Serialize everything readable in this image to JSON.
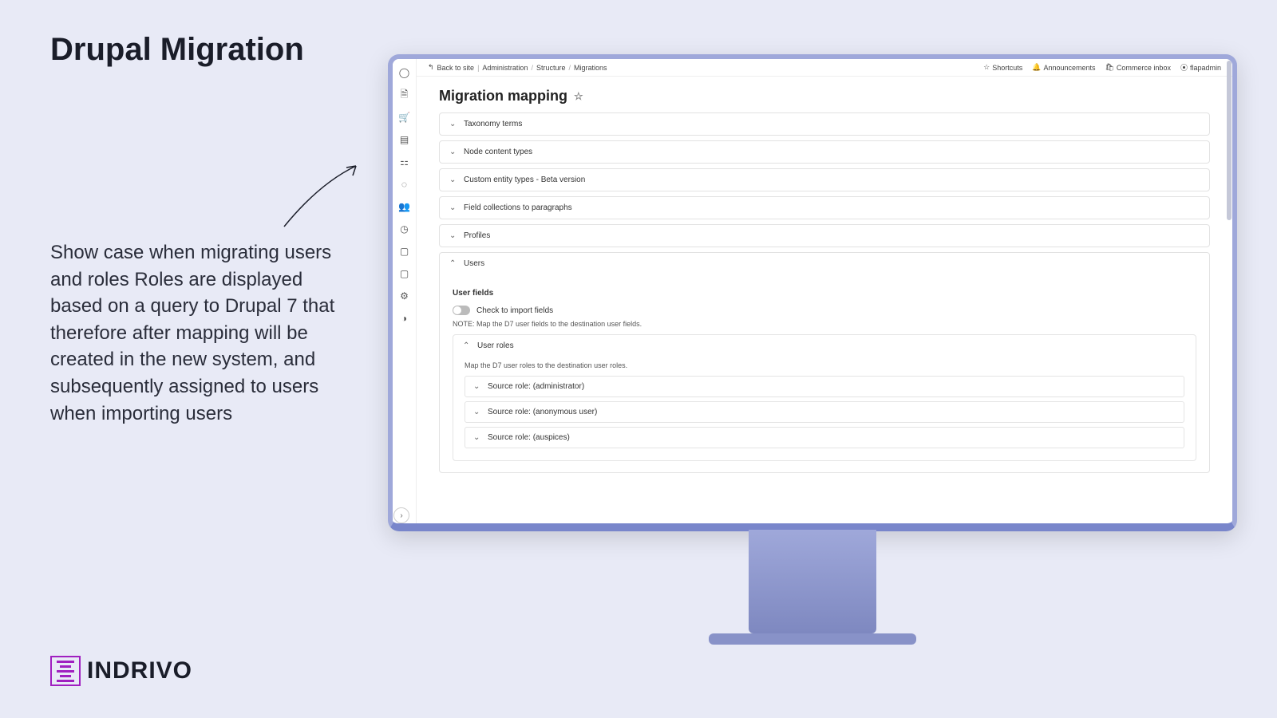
{
  "slide": {
    "title": "Drupal Migration",
    "callout": "Show case when migrating users and roles Roles are displayed based on a query to Drupal 7 that therefore after mapping will be created in the new system, and subsequently assigned to users when importing users"
  },
  "logo": {
    "text": "INDRIVO"
  },
  "admin": {
    "breadcrumb": {
      "back": "Back to site",
      "items": [
        "Administration",
        "Structure",
        "Migrations"
      ]
    },
    "topbar": {
      "shortcuts": "Shortcuts",
      "announcements": "Announcements",
      "commerce": "Commerce inbox",
      "user": "flapadmin"
    },
    "page_title": "Migration mapping",
    "accordions": [
      {
        "label": "Taxonomy terms",
        "open": false
      },
      {
        "label": "Node content types",
        "open": false
      },
      {
        "label": "Custom entity types - Beta version",
        "open": false
      },
      {
        "label": "Field collections to paragraphs",
        "open": false
      },
      {
        "label": "Profiles",
        "open": false
      },
      {
        "label": "Users",
        "open": true
      }
    ],
    "users_panel": {
      "fields_title": "User fields",
      "toggle_label": "Check to import fields",
      "note": "NOTE: Map the D7 user fields to the destination user fields.",
      "roles_title": "User roles",
      "roles_note": "Map the D7 user roles to the destination user roles.",
      "roles": [
        {
          "label": "Source role: (administrator)"
        },
        {
          "label": "Source role: (anonymous user)"
        },
        {
          "label": "Source role: (auspices)"
        }
      ]
    }
  }
}
